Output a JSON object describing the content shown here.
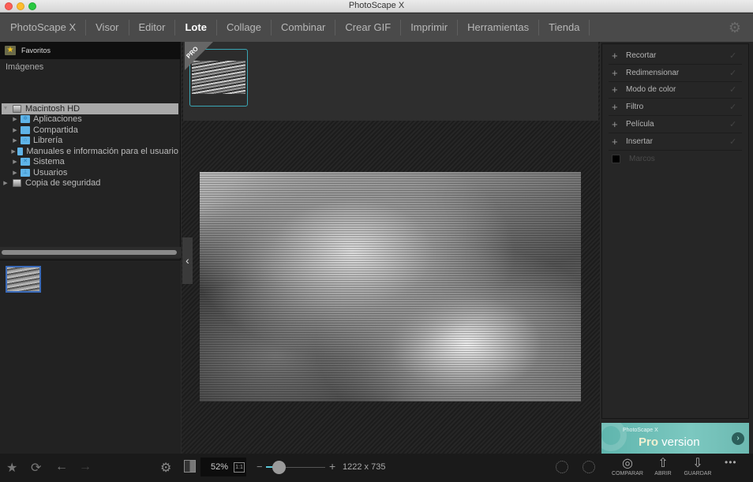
{
  "window": {
    "title": "PhotoScape X"
  },
  "nav": {
    "items": [
      {
        "label": "PhotoScape X",
        "active": false
      },
      {
        "label": "Visor",
        "active": false
      },
      {
        "label": "Editor",
        "active": false
      },
      {
        "label": "Lote",
        "active": true
      },
      {
        "label": "Collage",
        "active": false
      },
      {
        "label": "Combinar",
        "active": false
      },
      {
        "label": "Crear GIF",
        "active": false
      },
      {
        "label": "Imprimir",
        "active": false
      },
      {
        "label": "Herramientas",
        "active": false
      },
      {
        "label": "Tienda",
        "active": false
      }
    ],
    "settings_icon": "gear-icon"
  },
  "left_panel": {
    "favorites_label": "Favoritos",
    "images_label": "Imágenes",
    "tree": {
      "root": "Macintosh HD",
      "children": [
        "Aplicaciones",
        "Compartida",
        "Librería",
        "Manuales e información para el usuario",
        "Sistema",
        "Usuarios"
      ],
      "backup": "Copia de seguridad"
    }
  },
  "center": {
    "pro_badge": "PRO"
  },
  "right_panel": {
    "tools": [
      {
        "label": "Recortar"
      },
      {
        "label": "Redimensionar"
      },
      {
        "label": "Modo de color"
      },
      {
        "label": "Filtro"
      },
      {
        "label": "Película"
      },
      {
        "label": "Insertar"
      }
    ],
    "frames_label": "Marcos",
    "banner": {
      "small": "PhotoScape X",
      "pro": "Pro",
      "version": " version"
    }
  },
  "bottom": {
    "zoom": "52%",
    "one_to_one": "1:1",
    "dimensions": "1222 x 735",
    "actions": [
      {
        "label": "COMPARAR",
        "icon": "compare-icon"
      },
      {
        "label": "ABRIR",
        "icon": "open-icon"
      },
      {
        "label": "GUARDAR",
        "icon": "save-icon"
      }
    ],
    "more": "•••"
  }
}
